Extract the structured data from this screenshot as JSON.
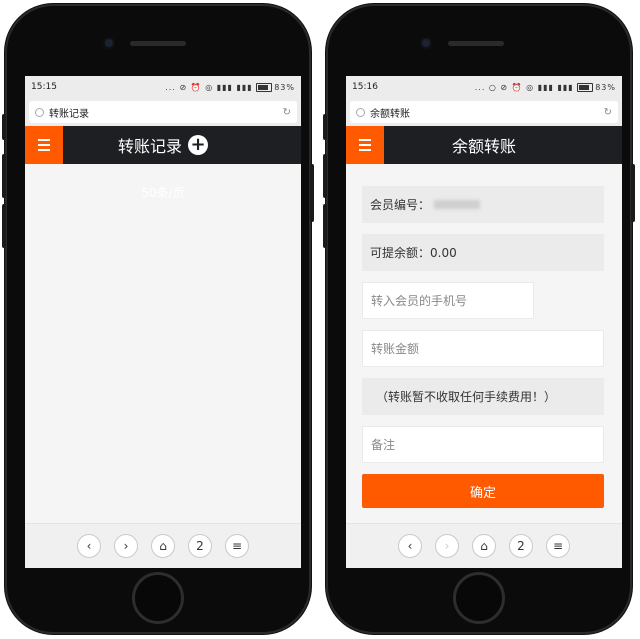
{
  "left": {
    "status": {
      "time": "15:15",
      "icons": "... ⊘ ⏰ ◎ ▮▮▮ ▮▮▮",
      "battery": "83%"
    },
    "url_title": "转账记录",
    "app_title": "转账记录",
    "add_glyph": "+",
    "per_page": "50条/页",
    "nav": [
      "‹",
      "›",
      "⌂",
      "2",
      "≡"
    ]
  },
  "right": {
    "status": {
      "time": "15:16",
      "icons": "... ○ ⊘ ⏰ ◎ ▮▮▮ ▮▮▮",
      "battery": "83%"
    },
    "url_title": "余额转账",
    "app_title": "余额转账",
    "member_label": "会员编号：",
    "withdrawable": "可提余额：0.00",
    "phone_placeholder": "转入会员的手机号",
    "amount_placeholder": "转账金额",
    "notice": "（转账暂不收取任何手续费用！）",
    "remark_placeholder": "备注",
    "confirm": "确定",
    "nav": [
      "‹",
      "›",
      "⌂",
      "2",
      "≡"
    ]
  },
  "colors": {
    "accent": "#ff5a00",
    "appbar": "#1e1f23"
  }
}
